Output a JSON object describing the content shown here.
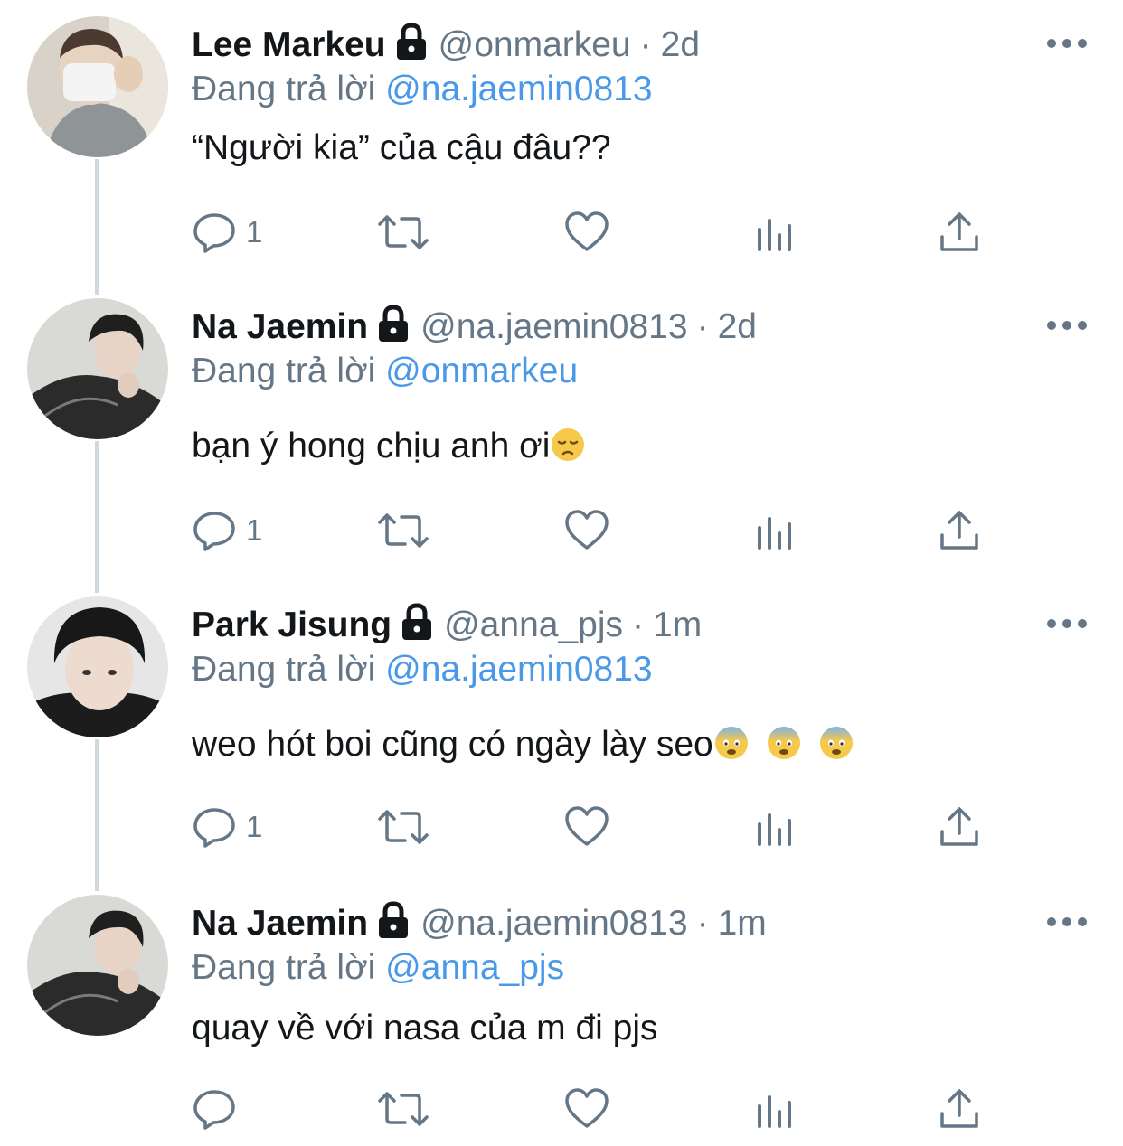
{
  "colors": {
    "mention": "#4a99e9",
    "secondary": "#657786",
    "thread_line": "#cfd9de"
  },
  "tweets": [
    {
      "name": "Lee Markeu",
      "handle": "@onmarkeu",
      "separator": "·",
      "time": "2d",
      "replying_label": "Đang trả lời",
      "replying_to": "@na.jaemin0813",
      "text": "“Người kia” của cậu đâu??",
      "reply_count": "1",
      "emojis": []
    },
    {
      "name": "Na Jaemin",
      "handle": "@na.jaemin0813",
      "separator": "·",
      "time": "2d",
      "replying_label": "Đang trả lời",
      "replying_to": "@onmarkeu",
      "text": "bạn ý hong chịu anh ơi",
      "reply_count": "1",
      "emojis": [
        "pensive-face-emoji"
      ]
    },
    {
      "name": "Park Jisung",
      "handle": "@anna_pjs",
      "separator": "·",
      "time": "1m",
      "replying_label": "Đang trả lời",
      "replying_to": "@na.jaemin0813",
      "text": "weo hót boi cũng có ngày lày seo",
      "reply_count": "1",
      "emojis": [
        "fearful-face-emoji",
        "fearful-face-emoji",
        "fearful-face-emoji"
      ]
    },
    {
      "name": "Na Jaemin",
      "handle": "@na.jaemin0813",
      "separator": "·",
      "time": "1m",
      "replying_label": "Đang trả lời",
      "replying_to": "@anna_pjs",
      "text": "quay về với nasa của m đi pjs",
      "reply_count": "",
      "emojis": []
    }
  ]
}
